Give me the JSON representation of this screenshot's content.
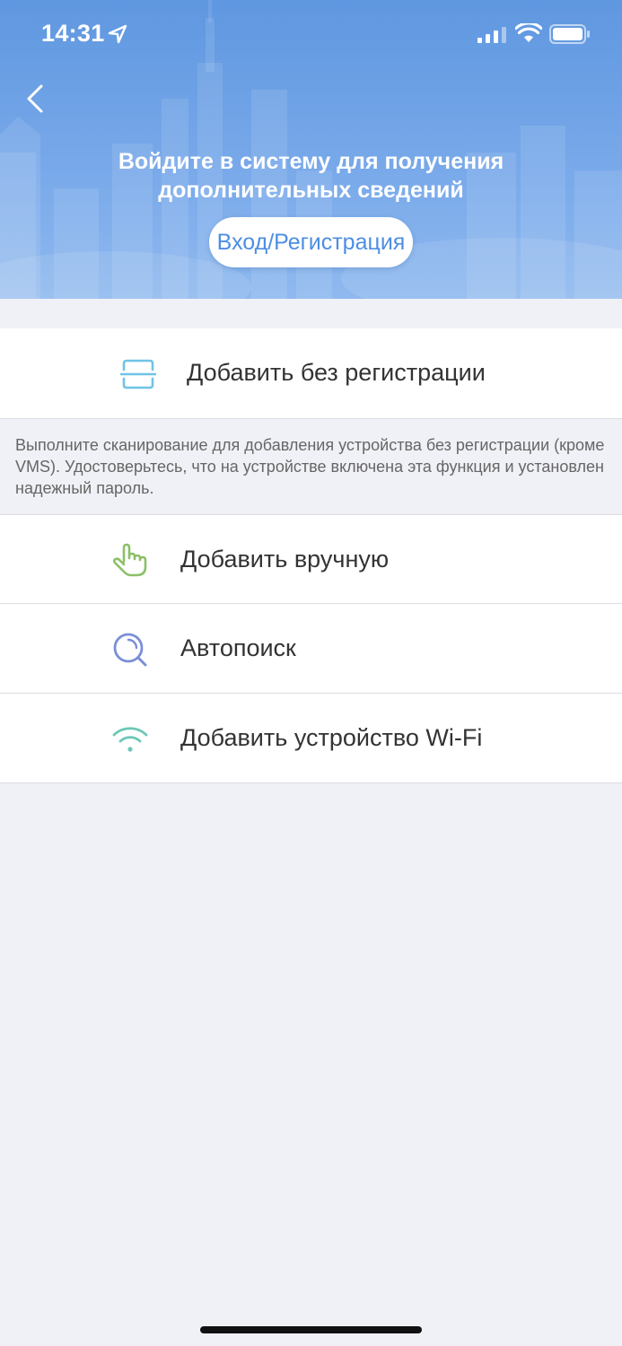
{
  "status_bar": {
    "time": "14:31",
    "icons": [
      "location-arrow-icon",
      "cellular-signal-icon",
      "wifi-icon",
      "battery-icon"
    ]
  },
  "header": {
    "back_icon": "chevron-left-icon",
    "prompt_line1": "Войдите в систему для получения",
    "prompt_line2": "дополнительных сведений",
    "login_button_label": "Вход/Регистрация"
  },
  "add_without_registration": {
    "icon": "scan-icon",
    "label": "Добавить без регистрации",
    "hint": "Выполните сканирование для добавления устройства без регистрации (кроме VMS). Удостоверьтесь, что на устройстве включена эта функция и установлен надежный пароль."
  },
  "menu": {
    "items": [
      {
        "icon": "hand-pointer-icon",
        "label": "Добавить вручную"
      },
      {
        "icon": "search-icon",
        "label": "Автопоиск"
      },
      {
        "icon": "wifi-icon",
        "label": "Добавить устройство Wi-Fi"
      }
    ]
  },
  "colors": {
    "header_top": "#5f97e0",
    "header_bottom": "#8fb9ef",
    "accent_blue": "#4d8ee3",
    "scan_icon": "#6fc3e6",
    "manual_icon": "#8cc068",
    "search_icon": "#7b8fd6",
    "wifi_icon": "#6cc7b8",
    "page_background": "#f0f1f6"
  }
}
